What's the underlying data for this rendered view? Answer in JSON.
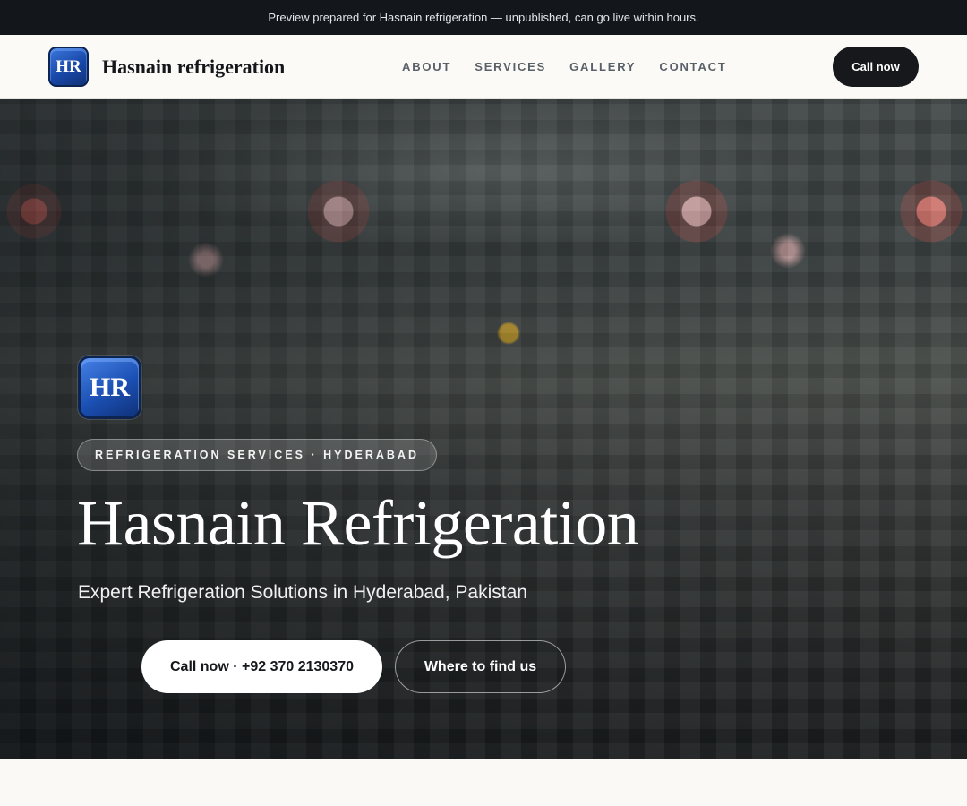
{
  "preview_bar": {
    "text": "Preview prepared for Hasnain refrigeration — unpublished, can go live within hours."
  },
  "header": {
    "logo_text": "HR",
    "brand_name": "Hasnain refrigeration",
    "nav": [
      {
        "label": "ABOUT"
      },
      {
        "label": "SERVICES"
      },
      {
        "label": "GALLERY"
      },
      {
        "label": "CONTACT"
      }
    ],
    "call_label": "Call now"
  },
  "hero": {
    "logo_text": "HR",
    "tag": "REFRIGERATION SERVICES · HYDERABAD",
    "title": "Hasnain Refrigeration",
    "subtitle": "Expert Refrigeration Solutions in Hyderabad, Pakistan",
    "primary_cta": "Call now · +92 370 2130370",
    "secondary_cta": "Where to find us",
    "background_image": "refrigeration shop interior with shelves and pendant lights"
  },
  "colors": {
    "top_bar": "#13161b",
    "nav_bg": "#fbfaf7",
    "dark_button": "#17181c",
    "logo_blue": "#1848a8",
    "page_bg": "#faf9f6"
  }
}
